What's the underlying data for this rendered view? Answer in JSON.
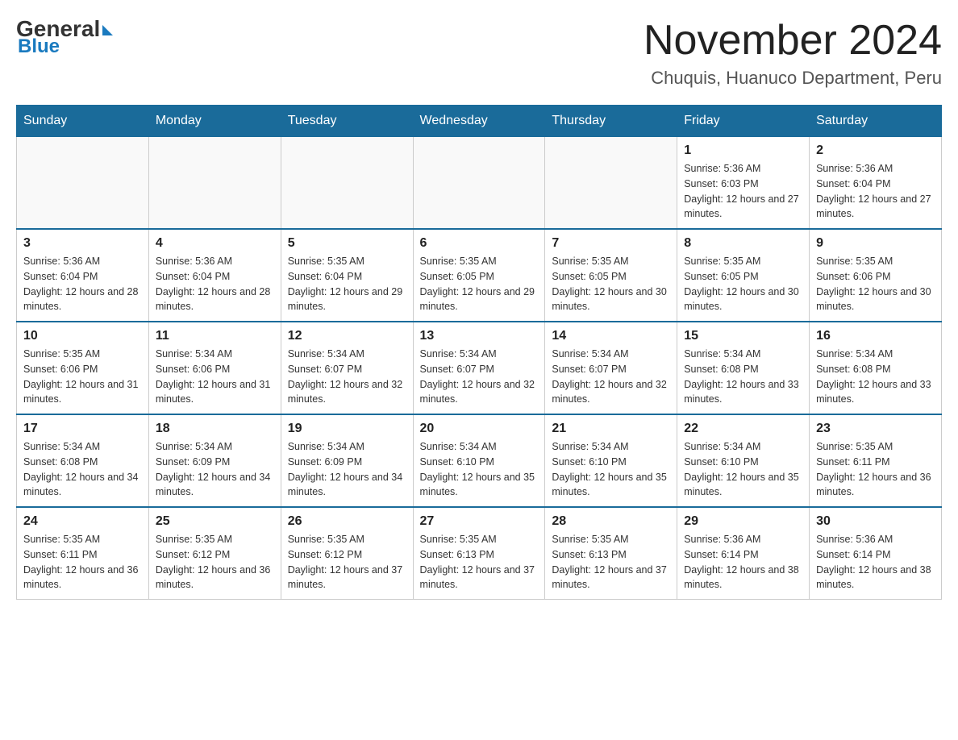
{
  "header": {
    "logo_general": "General",
    "logo_blue": "Blue",
    "month_title": "November 2024",
    "location": "Chuquis, Huanuco Department, Peru"
  },
  "weekdays": [
    "Sunday",
    "Monday",
    "Tuesday",
    "Wednesday",
    "Thursday",
    "Friday",
    "Saturday"
  ],
  "weeks": [
    [
      {
        "day": "",
        "sunrise": "",
        "sunset": "",
        "daylight": ""
      },
      {
        "day": "",
        "sunrise": "",
        "sunset": "",
        "daylight": ""
      },
      {
        "day": "",
        "sunrise": "",
        "sunset": "",
        "daylight": ""
      },
      {
        "day": "",
        "sunrise": "",
        "sunset": "",
        "daylight": ""
      },
      {
        "day": "",
        "sunrise": "",
        "sunset": "",
        "daylight": ""
      },
      {
        "day": "1",
        "sunrise": "Sunrise: 5:36 AM",
        "sunset": "Sunset: 6:03 PM",
        "daylight": "Daylight: 12 hours and 27 minutes."
      },
      {
        "day": "2",
        "sunrise": "Sunrise: 5:36 AM",
        "sunset": "Sunset: 6:04 PM",
        "daylight": "Daylight: 12 hours and 27 minutes."
      }
    ],
    [
      {
        "day": "3",
        "sunrise": "Sunrise: 5:36 AM",
        "sunset": "Sunset: 6:04 PM",
        "daylight": "Daylight: 12 hours and 28 minutes."
      },
      {
        "day": "4",
        "sunrise": "Sunrise: 5:36 AM",
        "sunset": "Sunset: 6:04 PM",
        "daylight": "Daylight: 12 hours and 28 minutes."
      },
      {
        "day": "5",
        "sunrise": "Sunrise: 5:35 AM",
        "sunset": "Sunset: 6:04 PM",
        "daylight": "Daylight: 12 hours and 29 minutes."
      },
      {
        "day": "6",
        "sunrise": "Sunrise: 5:35 AM",
        "sunset": "Sunset: 6:05 PM",
        "daylight": "Daylight: 12 hours and 29 minutes."
      },
      {
        "day": "7",
        "sunrise": "Sunrise: 5:35 AM",
        "sunset": "Sunset: 6:05 PM",
        "daylight": "Daylight: 12 hours and 30 minutes."
      },
      {
        "day": "8",
        "sunrise": "Sunrise: 5:35 AM",
        "sunset": "Sunset: 6:05 PM",
        "daylight": "Daylight: 12 hours and 30 minutes."
      },
      {
        "day": "9",
        "sunrise": "Sunrise: 5:35 AM",
        "sunset": "Sunset: 6:06 PM",
        "daylight": "Daylight: 12 hours and 30 minutes."
      }
    ],
    [
      {
        "day": "10",
        "sunrise": "Sunrise: 5:35 AM",
        "sunset": "Sunset: 6:06 PM",
        "daylight": "Daylight: 12 hours and 31 minutes."
      },
      {
        "day": "11",
        "sunrise": "Sunrise: 5:34 AM",
        "sunset": "Sunset: 6:06 PM",
        "daylight": "Daylight: 12 hours and 31 minutes."
      },
      {
        "day": "12",
        "sunrise": "Sunrise: 5:34 AM",
        "sunset": "Sunset: 6:07 PM",
        "daylight": "Daylight: 12 hours and 32 minutes."
      },
      {
        "day": "13",
        "sunrise": "Sunrise: 5:34 AM",
        "sunset": "Sunset: 6:07 PM",
        "daylight": "Daylight: 12 hours and 32 minutes."
      },
      {
        "day": "14",
        "sunrise": "Sunrise: 5:34 AM",
        "sunset": "Sunset: 6:07 PM",
        "daylight": "Daylight: 12 hours and 32 minutes."
      },
      {
        "day": "15",
        "sunrise": "Sunrise: 5:34 AM",
        "sunset": "Sunset: 6:08 PM",
        "daylight": "Daylight: 12 hours and 33 minutes."
      },
      {
        "day": "16",
        "sunrise": "Sunrise: 5:34 AM",
        "sunset": "Sunset: 6:08 PM",
        "daylight": "Daylight: 12 hours and 33 minutes."
      }
    ],
    [
      {
        "day": "17",
        "sunrise": "Sunrise: 5:34 AM",
        "sunset": "Sunset: 6:08 PM",
        "daylight": "Daylight: 12 hours and 34 minutes."
      },
      {
        "day": "18",
        "sunrise": "Sunrise: 5:34 AM",
        "sunset": "Sunset: 6:09 PM",
        "daylight": "Daylight: 12 hours and 34 minutes."
      },
      {
        "day": "19",
        "sunrise": "Sunrise: 5:34 AM",
        "sunset": "Sunset: 6:09 PM",
        "daylight": "Daylight: 12 hours and 34 minutes."
      },
      {
        "day": "20",
        "sunrise": "Sunrise: 5:34 AM",
        "sunset": "Sunset: 6:10 PM",
        "daylight": "Daylight: 12 hours and 35 minutes."
      },
      {
        "day": "21",
        "sunrise": "Sunrise: 5:34 AM",
        "sunset": "Sunset: 6:10 PM",
        "daylight": "Daylight: 12 hours and 35 minutes."
      },
      {
        "day": "22",
        "sunrise": "Sunrise: 5:34 AM",
        "sunset": "Sunset: 6:10 PM",
        "daylight": "Daylight: 12 hours and 35 minutes."
      },
      {
        "day": "23",
        "sunrise": "Sunrise: 5:35 AM",
        "sunset": "Sunset: 6:11 PM",
        "daylight": "Daylight: 12 hours and 36 minutes."
      }
    ],
    [
      {
        "day": "24",
        "sunrise": "Sunrise: 5:35 AM",
        "sunset": "Sunset: 6:11 PM",
        "daylight": "Daylight: 12 hours and 36 minutes."
      },
      {
        "day": "25",
        "sunrise": "Sunrise: 5:35 AM",
        "sunset": "Sunset: 6:12 PM",
        "daylight": "Daylight: 12 hours and 36 minutes."
      },
      {
        "day": "26",
        "sunrise": "Sunrise: 5:35 AM",
        "sunset": "Sunset: 6:12 PM",
        "daylight": "Daylight: 12 hours and 37 minutes."
      },
      {
        "day": "27",
        "sunrise": "Sunrise: 5:35 AM",
        "sunset": "Sunset: 6:13 PM",
        "daylight": "Daylight: 12 hours and 37 minutes."
      },
      {
        "day": "28",
        "sunrise": "Sunrise: 5:35 AM",
        "sunset": "Sunset: 6:13 PM",
        "daylight": "Daylight: 12 hours and 37 minutes."
      },
      {
        "day": "29",
        "sunrise": "Sunrise: 5:36 AM",
        "sunset": "Sunset: 6:14 PM",
        "daylight": "Daylight: 12 hours and 38 minutes."
      },
      {
        "day": "30",
        "sunrise": "Sunrise: 5:36 AM",
        "sunset": "Sunset: 6:14 PM",
        "daylight": "Daylight: 12 hours and 38 minutes."
      }
    ]
  ]
}
